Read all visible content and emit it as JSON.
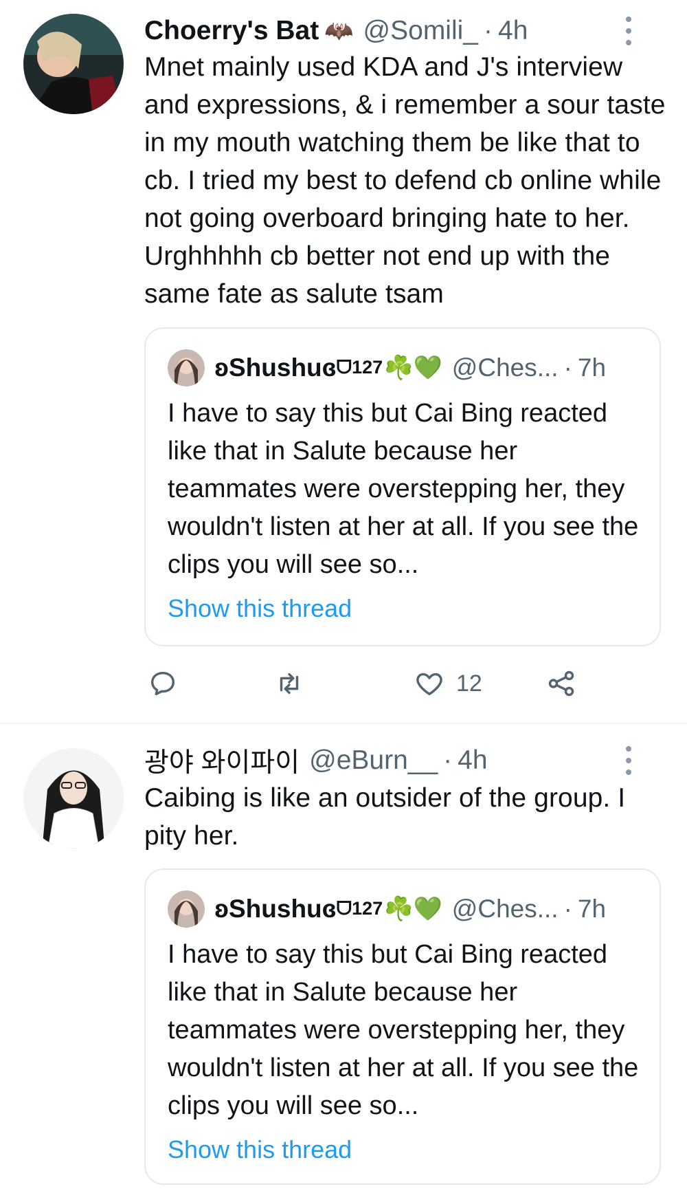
{
  "tweets": [
    {
      "author_name": "Choerry's Bat",
      "author_emoji": "🦇",
      "handle": "@Somili_",
      "separator": "·",
      "time": "4h",
      "text": "Mnet mainly used KDA and J's interview and expressions, & i remember a sour taste in my mouth watching them be like that to cb. I tried my best to defend cb online while not going overboard bringing hate to her. Urghhhhh cb better not end up with the same fate as salute tsam",
      "quote": {
        "author_name": "ʚShushuɞ",
        "badge": "ᗜ127",
        "emojis": "☘️💚",
        "handle": "@Ches...",
        "separator": "·",
        "time": "7h",
        "text": "I have to say this but Cai Bing reacted like that in Salute because her teammates were overstepping her, they wouldn't listen at her at all. If you see the clips you will see so...",
        "link": "Show this thread"
      },
      "actions": {
        "reply_icon": "reply-icon",
        "retweet_icon": "retweet-icon",
        "like_icon": "heart-icon",
        "like_count": "12",
        "share_icon": "share-icon"
      }
    },
    {
      "author_name": "광야 와이파이",
      "handle": "@eBurn__",
      "separator": "·",
      "time": "4h",
      "text": "Caibing is like an outsider of the group. I pity her.",
      "quote": {
        "author_name": "ʚShushuɞ",
        "badge": "ᗜ127",
        "emojis": "☘️💚",
        "handle": "@Ches...",
        "separator": "·",
        "time": "7h",
        "text": "I have to say this but Cai Bing reacted like that in Salute because her teammates were overstepping her, they wouldn't listen at her at all. If you see the clips you will see so...",
        "link": "Show this thread"
      }
    }
  ],
  "colors": {
    "text_primary": "#0f1419",
    "text_secondary": "#536471",
    "link": "#1d9bf0",
    "border": "#e5e9eb"
  }
}
